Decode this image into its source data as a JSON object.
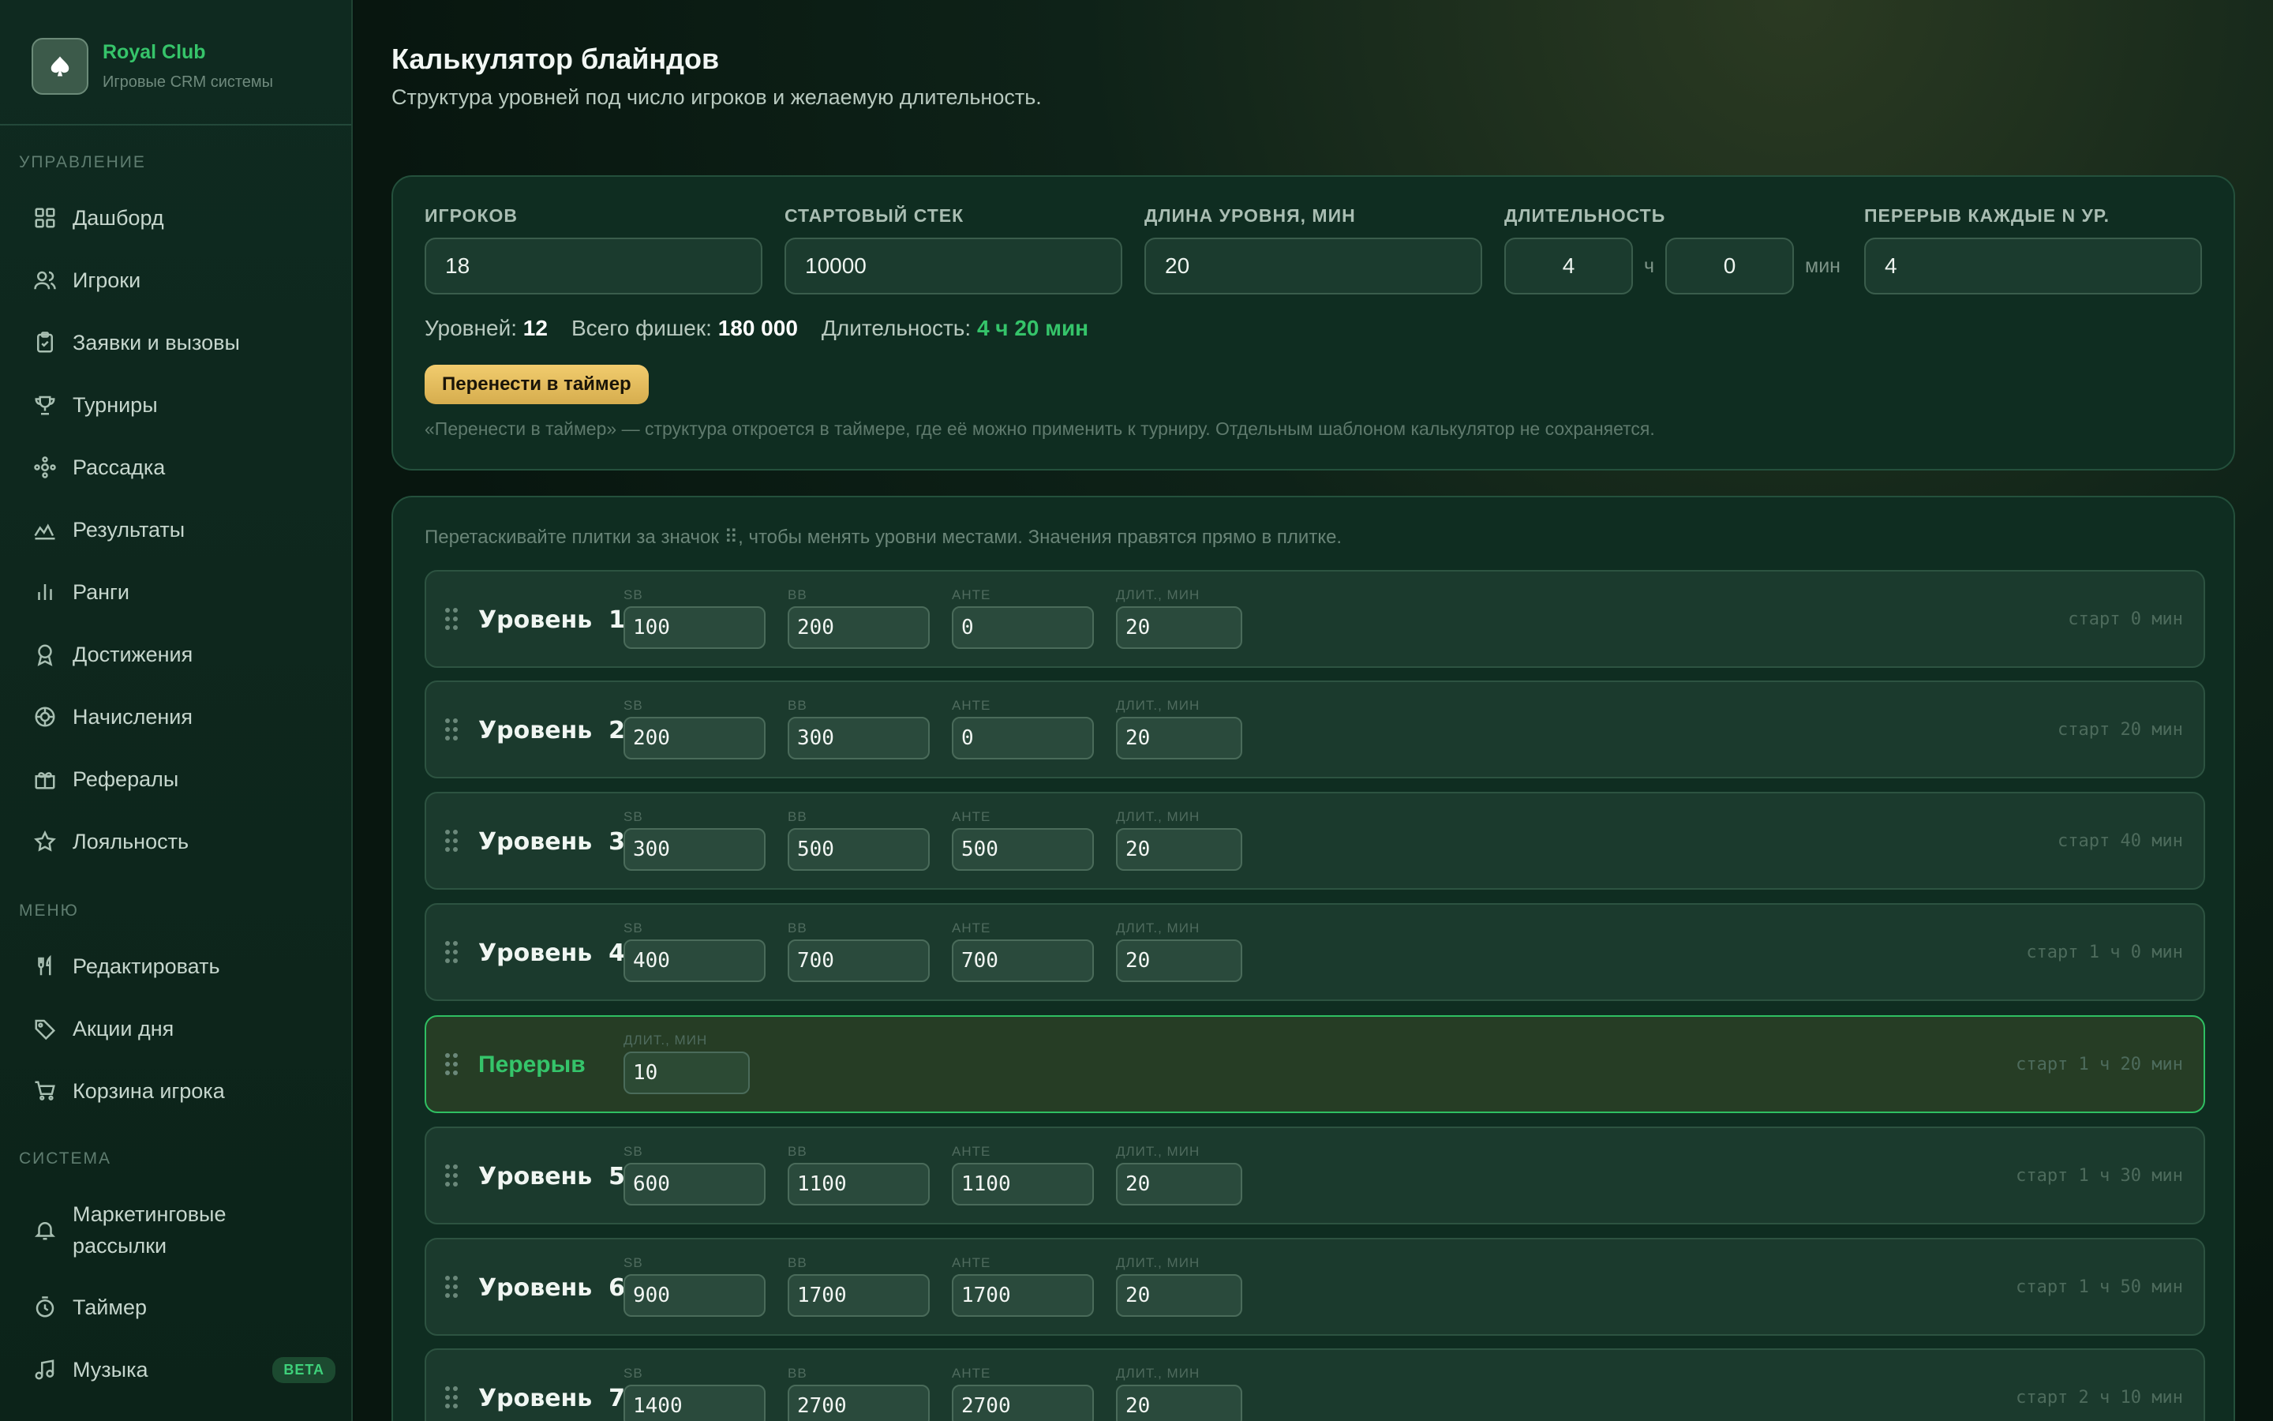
{
  "brand": {
    "name": "Royal Club",
    "sub": "Игровые CRM системы"
  },
  "sidebar": {
    "sections": [
      {
        "label": "УПРАВЛЕНИЕ"
      },
      {
        "label": "МЕНЮ"
      },
      {
        "label": "СИСТЕМА"
      }
    ],
    "items": [
      {
        "label": "Дашборд",
        "icon": "grid-icon"
      },
      {
        "label": "Игроки",
        "icon": "users-icon"
      },
      {
        "label": "Заявки и вызовы",
        "icon": "clipboard-icon"
      },
      {
        "label": "Турниры",
        "icon": "trophy-icon"
      },
      {
        "label": "Рассадка",
        "icon": "seating-icon"
      },
      {
        "label": "Результаты",
        "icon": "chart-wave-icon"
      },
      {
        "label": "Ранги",
        "icon": "bars-icon"
      },
      {
        "label": "Достижения",
        "icon": "medal-icon"
      },
      {
        "label": "Начисления",
        "icon": "chip-icon"
      },
      {
        "label": "Рефералы",
        "icon": "gift-icon"
      },
      {
        "label": "Лояльность",
        "icon": "star-icon"
      },
      {
        "label": "Редактировать",
        "icon": "fork-knife-icon"
      },
      {
        "label": "Акции дня",
        "icon": "tag-icon"
      },
      {
        "label": "Корзина игрока",
        "icon": "cart-icon"
      },
      {
        "label": "Маркетинговые рассылки",
        "icon": "bell-icon"
      },
      {
        "label": "Таймер",
        "icon": "timer-icon"
      },
      {
        "label": "Музыка",
        "icon": "music-icon",
        "badge": "BETA"
      }
    ]
  },
  "page": {
    "title": "Калькулятор блайндов",
    "subtitle": "Структура уровней под число игроков и желаемую длительность."
  },
  "form": {
    "players": {
      "label": "ИГРОКОВ",
      "value": "18"
    },
    "stack": {
      "label": "СТАРТОВЫЙ СТЕК",
      "value": "10000"
    },
    "level_length": {
      "label": "ДЛИНА УРОВНЯ, МИН",
      "value": "20"
    },
    "duration": {
      "label": "ДЛИТЕЛЬНОСТЬ",
      "hours": "4",
      "hours_unit": "ч",
      "minutes": "0",
      "minutes_unit": "мин"
    },
    "break_every": {
      "label": "ПЕРЕРЫВ КАЖДЫЕ N УР.",
      "value": "4"
    }
  },
  "stats": {
    "levels_label": "Уровней:",
    "levels_value": "12",
    "chips_label": "Всего фишек:",
    "chips_value": "180 000",
    "duration_label": "Длительность:",
    "duration_value": "4 ч 20 мин"
  },
  "transfer_button": "Перенести в таймер",
  "transfer_hint": "«Перенести в таймер» — структура откроется в таймере, где её можно применить к турниру. Отдельным шаблоном калькулятор не сохраняется.",
  "levels_hint": "Перетаскивайте плитки за значок ⠿, чтобы менять уровни местами. Значения правятся прямо в плитке.",
  "col_labels": {
    "sb": "SB",
    "bb": "BB",
    "ante": "АНТЕ",
    "dur": "ДЛИТ., МИН"
  },
  "levels": [
    {
      "title": "Уровень  1",
      "sb": "100",
      "bb": "200",
      "ante": "0",
      "dur": "20",
      "start": "старт 0 мин"
    },
    {
      "title": "Уровень  2",
      "sb": "200",
      "bb": "300",
      "ante": "0",
      "dur": "20",
      "start": "старт 20 мин"
    },
    {
      "title": "Уровень  3",
      "sb": "300",
      "bb": "500",
      "ante": "500",
      "dur": "20",
      "start": "старт 40 мин"
    },
    {
      "title": "Уровень  4",
      "sb": "400",
      "bb": "700",
      "ante": "700",
      "dur": "20",
      "start": "старт 1 ч 0 мин"
    },
    {
      "title": "Перерыв",
      "break": true,
      "dur": "10",
      "start": "старт 1 ч 20 мин"
    },
    {
      "title": "Уровень  5",
      "sb": "600",
      "bb": "1100",
      "ante": "1100",
      "dur": "20",
      "start": "старт 1 ч 30 мин"
    },
    {
      "title": "Уровень  6",
      "sb": "900",
      "bb": "1700",
      "ante": "1700",
      "dur": "20",
      "start": "старт 1 ч 50 мин"
    },
    {
      "title": "Уровень  7",
      "sb": "1400",
      "bb": "2700",
      "ante": "2700",
      "dur": "20",
      "start": "старт 2 ч 10 мин"
    }
  ]
}
